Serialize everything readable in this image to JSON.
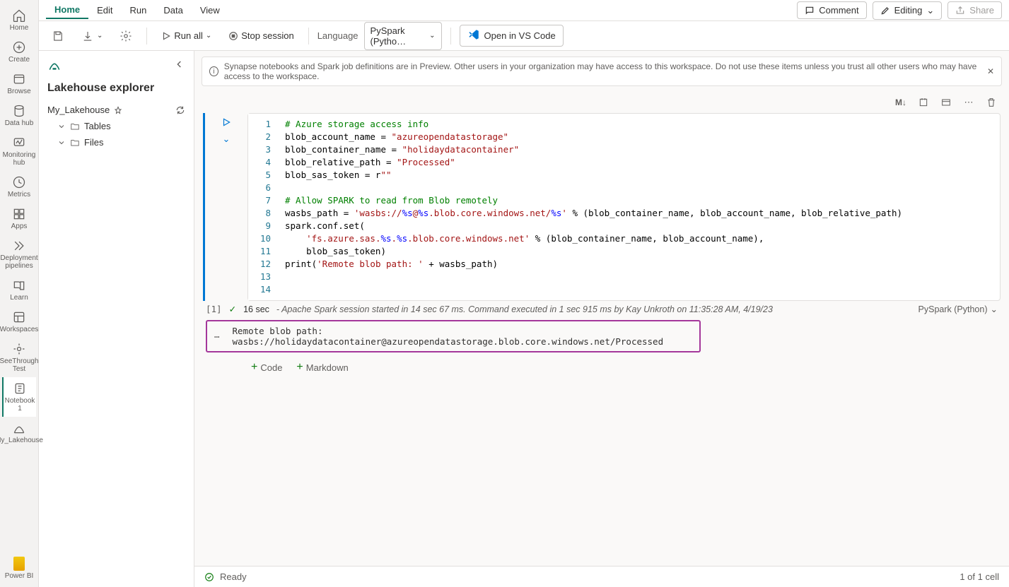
{
  "rail": {
    "items": [
      {
        "label": "Home"
      },
      {
        "label": "Create"
      },
      {
        "label": "Browse"
      },
      {
        "label": "Data hub"
      },
      {
        "label": "Monitoring hub"
      },
      {
        "label": "Metrics"
      },
      {
        "label": "Apps"
      },
      {
        "label": "Deployment pipelines"
      },
      {
        "label": "Learn"
      },
      {
        "label": "Workspaces"
      },
      {
        "label": "SeeThrough Test"
      },
      {
        "label": "Notebook 1"
      },
      {
        "label": "My_Lakehouse"
      }
    ],
    "powerbi": "Power BI"
  },
  "tabs": {
    "items": [
      "Home",
      "Edit",
      "Run",
      "Data",
      "View"
    ],
    "active": "Home",
    "comment": "Comment",
    "editing": "Editing",
    "share": "Share"
  },
  "toolbar": {
    "runall": "Run all",
    "stop": "Stop session",
    "lang_label": "Language",
    "lang_value": "PySpark (Pytho…",
    "vscode": "Open in VS Code"
  },
  "explorer": {
    "title": "Lakehouse explorer",
    "lakehouse": "My_Lakehouse",
    "tables": "Tables",
    "files": "Files"
  },
  "banner": {
    "text": "Synapse notebooks and Spark job definitions are in Preview. Other users in your organization may have access to this workspace. Do not use these items unless you trust all other users who may have access to the workspace."
  },
  "cell_toolbar": {
    "md": "M↓"
  },
  "code": {
    "lines": [
      {
        "n": 1,
        "segs": [
          {
            "c": "tok-comment",
            "t": "# Azure storage access info"
          }
        ]
      },
      {
        "n": 2,
        "segs": [
          {
            "c": "tok-var",
            "t": "blob_account_name = "
          },
          {
            "c": "tok-str",
            "t": "\"azureopendatastorage\""
          }
        ]
      },
      {
        "n": 3,
        "segs": [
          {
            "c": "tok-var",
            "t": "blob_container_name = "
          },
          {
            "c": "tok-str",
            "t": "\"holidaydatacontainer\""
          }
        ]
      },
      {
        "n": 4,
        "segs": [
          {
            "c": "tok-var",
            "t": "blob_relative_path = "
          },
          {
            "c": "tok-str",
            "t": "\"Processed\""
          }
        ]
      },
      {
        "n": 5,
        "segs": [
          {
            "c": "tok-var",
            "t": "blob_sas_token = r"
          },
          {
            "c": "tok-str",
            "t": "\"\""
          }
        ]
      },
      {
        "n": 6,
        "segs": [
          {
            "c": "tok-var",
            "t": ""
          }
        ]
      },
      {
        "n": 7,
        "segs": [
          {
            "c": "tok-comment",
            "t": "# Allow SPARK to read from Blob remotely"
          }
        ]
      },
      {
        "n": 8,
        "segs": [
          {
            "c": "tok-var",
            "t": "wasbs_path = "
          },
          {
            "c": "tok-str",
            "t": "'wasbs://"
          },
          {
            "c": "tok-fmt",
            "t": "%s"
          },
          {
            "c": "tok-str",
            "t": "@"
          },
          {
            "c": "tok-fmt",
            "t": "%s"
          },
          {
            "c": "tok-str",
            "t": ".blob.core.windows.net/"
          },
          {
            "c": "tok-fmt",
            "t": "%s"
          },
          {
            "c": "tok-str",
            "t": "'"
          },
          {
            "c": "tok-var",
            "t": " % (blob_container_name, blob_account_name, blob_relative_path)"
          }
        ]
      },
      {
        "n": 9,
        "segs": [
          {
            "c": "tok-var",
            "t": "spark.conf.set("
          }
        ]
      },
      {
        "n": 10,
        "segs": [
          {
            "c": "tok-var",
            "t": "    "
          },
          {
            "c": "tok-str",
            "t": "'fs.azure.sas."
          },
          {
            "c": "tok-fmt",
            "t": "%s"
          },
          {
            "c": "tok-str",
            "t": "."
          },
          {
            "c": "tok-fmt",
            "t": "%s"
          },
          {
            "c": "tok-str",
            "t": ".blob.core.windows.net'"
          },
          {
            "c": "tok-var",
            "t": " % (blob_container_name, blob_account_name),"
          }
        ]
      },
      {
        "n": 11,
        "segs": [
          {
            "c": "tok-var",
            "t": "    blob_sas_token)"
          }
        ]
      },
      {
        "n": 12,
        "segs": [
          {
            "c": "tok-var",
            "t": "print("
          },
          {
            "c": "tok-str",
            "t": "'Remote blob path: '"
          },
          {
            "c": "tok-var",
            "t": " + wasbs_path)"
          }
        ]
      },
      {
        "n": 13,
        "segs": [
          {
            "c": "tok-var",
            "t": ""
          }
        ]
      },
      {
        "n": 14,
        "segs": [
          {
            "c": "tok-var",
            "t": ""
          }
        ]
      }
    ]
  },
  "status": {
    "idx": "[1]",
    "time": "16 sec",
    "meta": "- Apache Spark session started in 14 sec 67 ms. Command executed in 1 sec 915 ms by Kay Unkroth on 11:35:28 AM, 4/19/23",
    "lang": "PySpark (Python)"
  },
  "output": {
    "text": "Remote blob path: wasbs://holidaydatacontainer@azureopendatastorage.blob.core.windows.net/Processed"
  },
  "add": {
    "code": "Code",
    "markdown": "Markdown"
  },
  "statusbar": {
    "ready": "Ready",
    "cells": "1 of 1 cell"
  }
}
